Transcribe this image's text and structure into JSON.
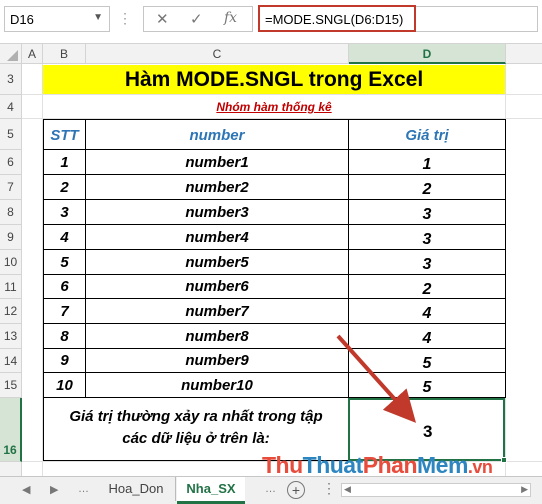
{
  "formula_bar": {
    "name_box": "D16",
    "formula": "=MODE.SNGL(D6:D15)",
    "fx_label": "fx"
  },
  "columns": [
    "A",
    "B",
    "C",
    "D"
  ],
  "selected_column": "D",
  "rows": [
    "3",
    "4",
    "5",
    "6",
    "7",
    "8",
    "9",
    "10",
    "11",
    "12",
    "13",
    "14",
    "15",
    "16"
  ],
  "selected_row": "16",
  "sheet": {
    "title": "Hàm MODE.SNGL trong Excel",
    "subtitle": "Nhóm hàm thống kê",
    "headers": {
      "stt": "STT",
      "number": "number",
      "value": "Giá trị"
    },
    "data": [
      {
        "stt": "1",
        "name": "number1",
        "value": "1"
      },
      {
        "stt": "2",
        "name": "number2",
        "value": "2"
      },
      {
        "stt": "3",
        "name": "number3",
        "value": "3"
      },
      {
        "stt": "4",
        "name": "number4",
        "value": "3"
      },
      {
        "stt": "5",
        "name": "number5",
        "value": "3"
      },
      {
        "stt": "6",
        "name": "number6",
        "value": "2"
      },
      {
        "stt": "7",
        "name": "number7",
        "value": "4"
      },
      {
        "stt": "8",
        "name": "number8",
        "value": "4"
      },
      {
        "stt": "9",
        "name": "number9",
        "value": "5"
      },
      {
        "stt": "10",
        "name": "number10",
        "value": "5"
      }
    ],
    "result_label_line1": "Giá trị thường xảy ra nhất trong tập",
    "result_label_line2": "các dữ liệu ở trên là:",
    "result_value": "3"
  },
  "tabs": {
    "sheet1": "Hoa_Don",
    "sheet2": "Nha_SX",
    "add": "+"
  },
  "watermark": {
    "part1": "Thu",
    "part2": "Thuat",
    "part3": "Phan",
    "part4": "Mem",
    "part5": ".vn"
  },
  "colors": {
    "accent": "#217346",
    "title_bg": "#ffff00",
    "header_text": "#2e75b6",
    "subtitle_text": "#c00000",
    "formula_border": "#c0392b",
    "arrow": "#c0392b"
  }
}
